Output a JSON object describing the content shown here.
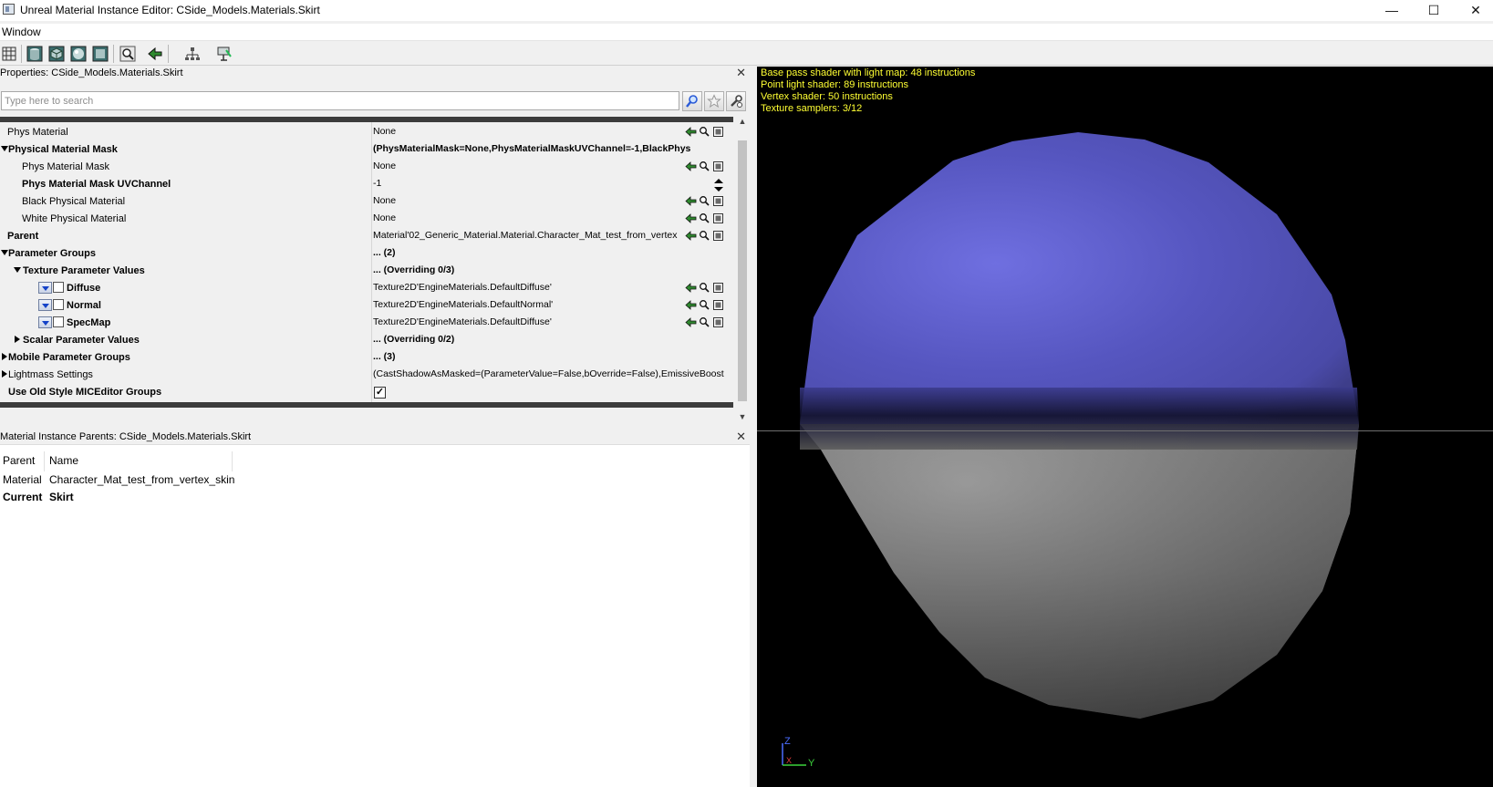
{
  "window": {
    "title": "Unreal Material Instance Editor: CSide_Models.Materials.Skirt",
    "controls": [
      "—",
      "☐",
      "✕"
    ]
  },
  "menu": {
    "items": [
      "Window"
    ]
  },
  "toolbar": {
    "icons": [
      "grid-icon",
      "cylinder-icon",
      "cube-icon",
      "sphere-icon",
      "plane-icon",
      "magnify-icon",
      "back-arrow-icon",
      "hierarchy-icon",
      "clean-icon"
    ]
  },
  "properties": {
    "title": "Properties: CSide_Models.Materials.Skirt",
    "search_placeholder": "Type here to search",
    "rows": [
      {
        "name": "Phys Material",
        "value": "None"
      },
      {
        "name": "Physical Material Mask",
        "value": "(PhysMaterialMask=None,PhysMaterialMaskUVChannel=-1,BlackPhys"
      },
      {
        "name": "Phys Material Mask",
        "value": "None"
      },
      {
        "name": "Phys Material Mask UVChannel",
        "value": "-1"
      },
      {
        "name": "Black Physical Material",
        "value": "None"
      },
      {
        "name": "White Physical Material",
        "value": "None"
      },
      {
        "name": "Parent",
        "value": "Material'02_Generic_Material.Material.Character_Mat_test_from_vertex"
      },
      {
        "name": "Parameter Groups",
        "value": "... (2)"
      },
      {
        "name": "Texture Parameter Values",
        "value": "... (Overriding 0/3)"
      },
      {
        "name": "Diffuse",
        "value": "Texture2D'EngineMaterials.DefaultDiffuse'"
      },
      {
        "name": "Normal",
        "value": "Texture2D'EngineMaterials.DefaultNormal'"
      },
      {
        "name": "SpecMap",
        "value": "Texture2D'EngineMaterials.DefaultDiffuse'"
      },
      {
        "name": "Scalar Parameter Values",
        "value": "... (Overriding 0/2)"
      },
      {
        "name": "Mobile Parameter Groups",
        "value": "... (3)"
      },
      {
        "name": "Lightmass Settings",
        "value": "(CastShadowAsMasked=(ParameterValue=False,bOverride=False),EmissiveBoost"
      },
      {
        "name": "Use Old Style MICEditor Groups",
        "value": "✓"
      }
    ]
  },
  "parents": {
    "title": "Material Instance Parents: CSide_Models.Materials.Skirt",
    "columns": [
      "Parent",
      "Name"
    ],
    "rows": [
      {
        "parent": "Material",
        "name": "Character_Mat_test_from_vertex_skin"
      },
      {
        "parent": "Current",
        "name": "Skirt"
      }
    ]
  },
  "viewport": {
    "stats": [
      "Base pass shader with light map: 48 instructions",
      "Point light shader: 89 instructions",
      "Vertex shader: 50 instructions",
      "Texture samplers: 3/12"
    ],
    "axis": {
      "z": "Z",
      "x": "X",
      "y": "Y"
    },
    "stat_color": "#ffff33",
    "sphere_top_color": "#5a5ac8",
    "sphere_bottom_color": "#8a8a8a"
  }
}
